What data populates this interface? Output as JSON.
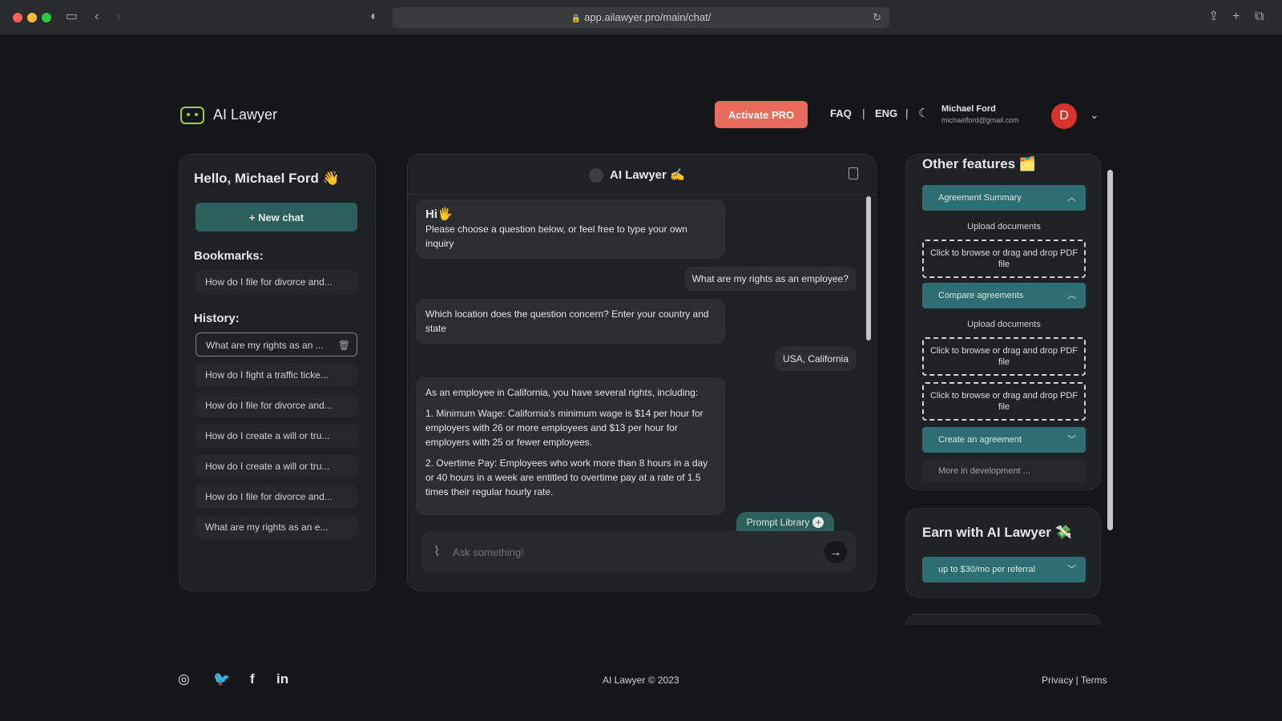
{
  "browser": {
    "url": "app.ailawyer.pro/main/chat/"
  },
  "header": {
    "brand": "AI Lawyer",
    "activate_label": "Activate PRO",
    "faq_label": "FAQ",
    "lang_label": "ENG",
    "user_name": "Michael Ford",
    "user_email": "michaelford@gmail.com",
    "avatar_initial": "D"
  },
  "sidebar": {
    "greeting": "Hello, Michael Ford 👋",
    "new_chat_label": "+ New chat",
    "bookmarks_label": "Bookmarks:",
    "bookmarks": [
      "How do I file for divorce and..."
    ],
    "history_label": "History:",
    "history": [
      "What are my rights as an ...",
      "How do I fight a traffic ticke...",
      "How do I file for divorce and...",
      "How do I create a will or tru...",
      "How do I create a will or tru...",
      "How do I file for divorce and...",
      "What are my rights as an e..."
    ]
  },
  "chat": {
    "title": "AI Lawyer ✍️",
    "greeting": "Hi🖐️",
    "intro": "Please choose a question below, or feel free to type your own inquiry",
    "user_q1": "What are my rights as an employee?",
    "bot_q": "Which location does the question concern? Enter your country and state",
    "user_q2": "USA, California",
    "answer_intro": "As an employee in California, you have several rights, including:",
    "answer_p1": "1. Minimum Wage: California's minimum wage is $14 per hour for employers with 26 or more employees and $13 per hour for employers with 25 or fewer employees.",
    "answer_p2": "2. Overtime Pay: Employees who work more than 8 hours in a day or 40 hours in a week are entitled to overtime pay at a rate of 1.5 times their regular hourly rate.",
    "prompt_library_label": "Prompt Library",
    "input_placeholder": "Ask something!"
  },
  "features": {
    "title": "Other features 🗂️",
    "agreement_summary": "Agreement Summary",
    "upload_documents_1": "Upload documents",
    "dropzone_1": "Click to browse or drag and drop PDF file",
    "compare_agreements": "Compare agreements",
    "upload_documents_2": "Upload documents",
    "dropzone_2": "Click to browse or drag and drop PDF file",
    "dropzone_3": "Click to browse or drag and drop PDF file",
    "create_agreement": "Create an agreement",
    "more_dev": "More in development ..."
  },
  "earn": {
    "title": "Earn with AI Lawyer 💸",
    "referral": "up to $30/mo per referral"
  },
  "footer": {
    "copyright": "AI Lawyer © 2023",
    "legal": "Privacy | Terms"
  }
}
